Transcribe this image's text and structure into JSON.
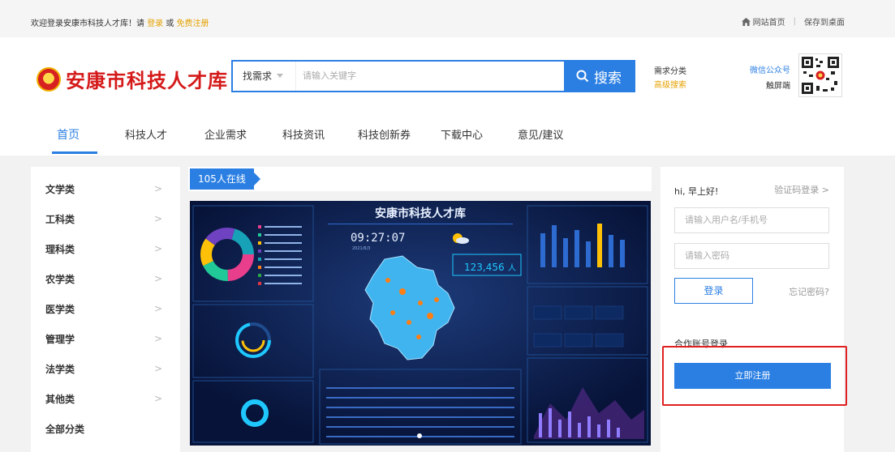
{
  "topbar": {
    "welcome": "欢迎登录安康市科技人才库！请",
    "login": "登录",
    "or": "或",
    "register": "免费注册",
    "home": "网站首页",
    "divider": "|",
    "save": "保存到桌面"
  },
  "header": {
    "logo_text": "安康市科技人才库",
    "search_category": "找需求",
    "search_placeholder": "请输入关键字",
    "search_button": "搜索",
    "link_demand": "需求分类",
    "link_advanced": "高级搜索",
    "wechat": "微信公众号",
    "touch": "触屏端"
  },
  "nav": {
    "items": [
      "首页",
      "科技人才",
      "企业需求",
      "科技资讯",
      "科技创新券",
      "下载中心",
      "意见/建议"
    ]
  },
  "sidebar": {
    "categories": [
      "文学类",
      "工科类",
      "理科类",
      "农学类",
      "医学类",
      "管理学",
      "法学类",
      "其他类",
      "全部分类"
    ]
  },
  "online": {
    "label": "105人在线"
  },
  "dashboard": {
    "title": "安康市科技人才库",
    "time": "09:27:07",
    "date": "2021/6/3",
    "count": "123,456",
    "count_unit": "人"
  },
  "login": {
    "greeting": "hi, 早上好!",
    "code_login": "验证码登录 >",
    "username_placeholder": "请输入用户名/手机号",
    "password_placeholder": "请输入密码",
    "login_button": "登录",
    "forgot": "忘记密码?",
    "cooperation": "合作账号登录",
    "register_button": "立即注册"
  },
  "colors": {
    "brand_blue": "#2b7fe3",
    "logo_red": "#d51a1a",
    "highlight_red": "#e02020",
    "link_orange": "#e5a100"
  }
}
